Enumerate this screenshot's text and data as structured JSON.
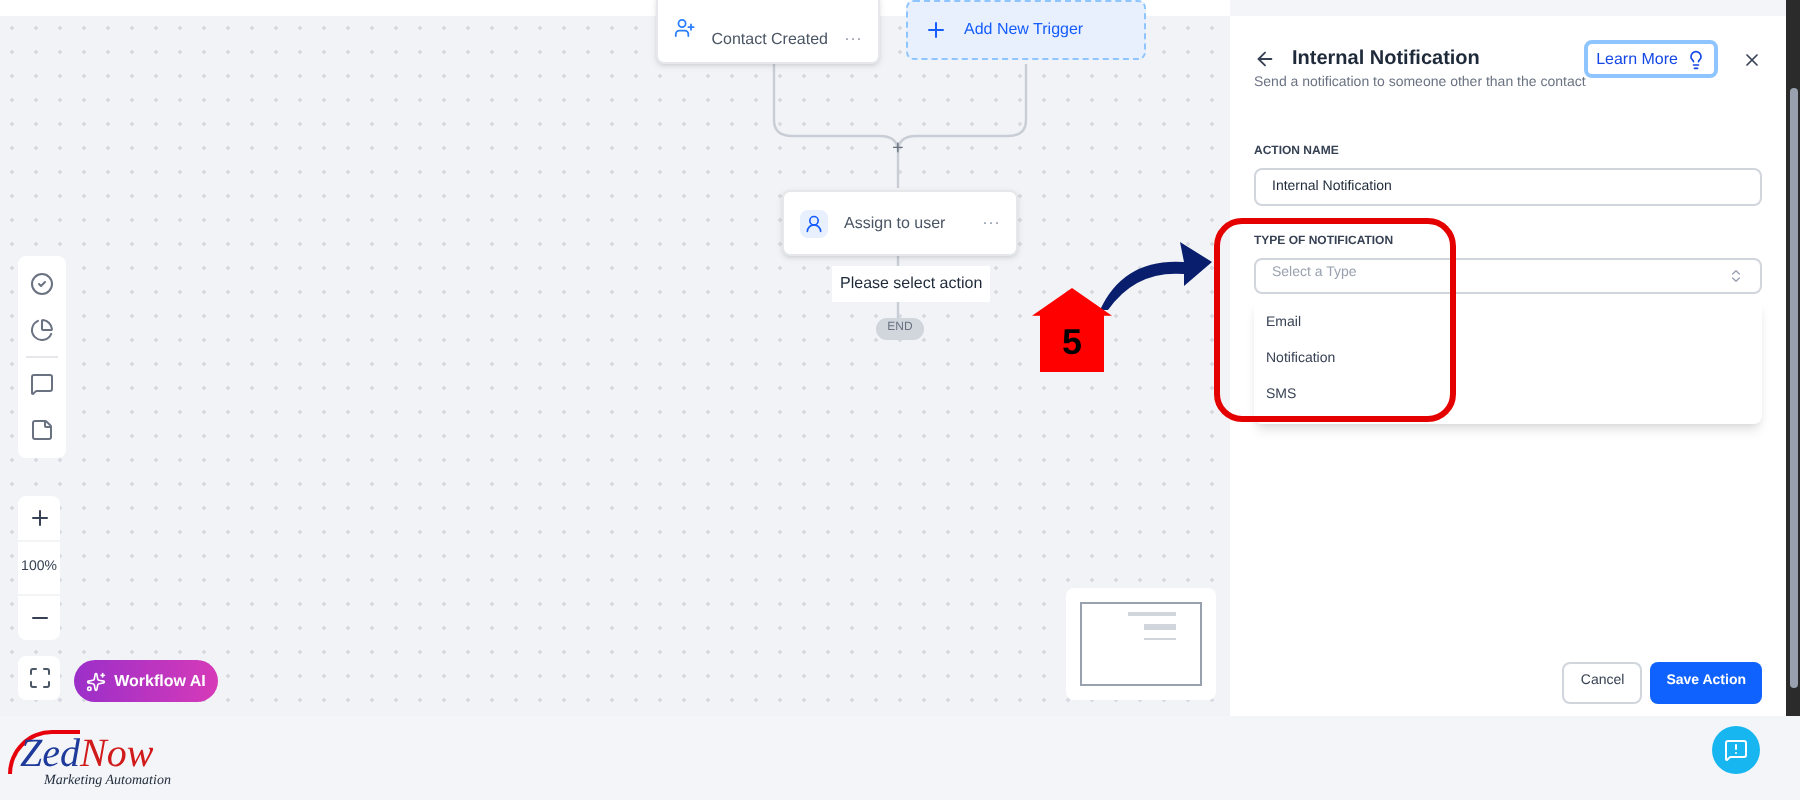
{
  "canvas": {
    "trigger": {
      "subtitle": "Contact Created",
      "menu": "···"
    },
    "add_trigger": {
      "label": "Add New Trigger"
    },
    "add_step": "+",
    "action_node": {
      "label": "Assign to user",
      "menu": "···"
    },
    "hint": "Please select action",
    "end": "END"
  },
  "zoom_level": "100%",
  "ai_button": "Workflow AI",
  "panel": {
    "title": "Internal Notification",
    "subtitle": "Send a notification to someone other than the contact",
    "learn_more": "Learn More",
    "action_name": {
      "label": "ACTION NAME",
      "value": "Internal Notification"
    },
    "type_field": {
      "label": "TYPE OF NOTIFICATION",
      "placeholder": "Select a Type",
      "options": [
        "Email",
        "Notification",
        "SMS"
      ]
    },
    "cancel": "Cancel",
    "save": "Save Action"
  },
  "annotation": {
    "step": "5"
  },
  "logo": {
    "words": [
      "Zed",
      "Now"
    ],
    "tagline": "Marketing Automation"
  }
}
